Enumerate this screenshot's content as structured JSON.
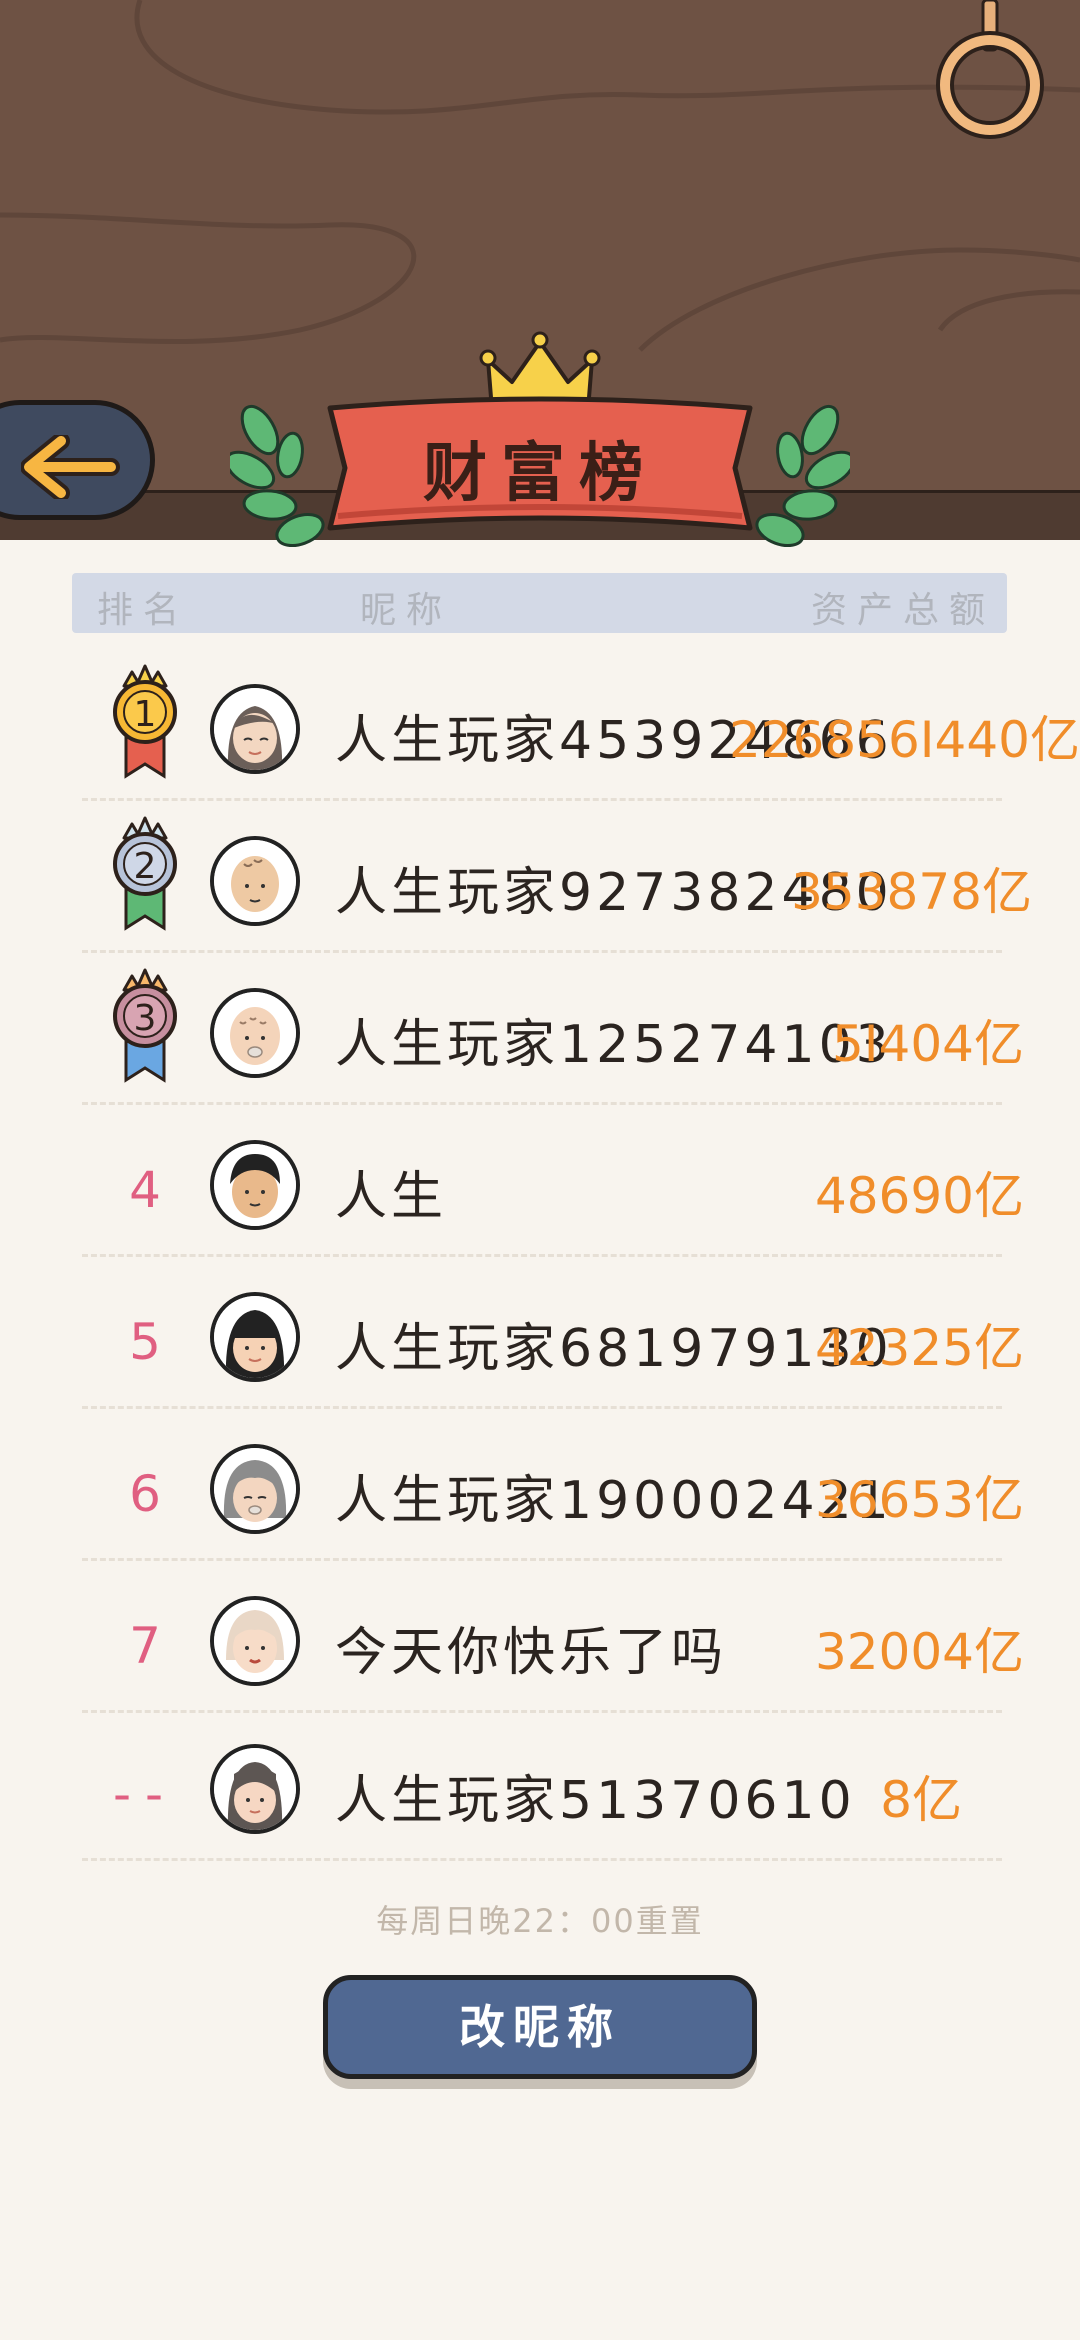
{
  "header": {
    "title": "财富榜",
    "back_icon": "back-arrow-icon",
    "crown_icon": "crown-icon",
    "laurel_icon": "laurel-icon"
  },
  "table": {
    "columns": [
      "排名",
      "昵称",
      "资产总额"
    ]
  },
  "rows": [
    {
      "rank": "1",
      "nickname": "人生玩家453924866",
      "wealth": "226856I440亿"
    },
    {
      "rank": "2",
      "nickname": "人生玩家927382480",
      "wealth": "353878亿"
    },
    {
      "rank": "3",
      "nickname": "人生玩家125274103",
      "wealth": "5I404亿"
    },
    {
      "rank": "4",
      "nickname": "人生",
      "wealth": "48690亿"
    },
    {
      "rank": "5",
      "nickname": "人生玩家681979130",
      "wealth": "42325亿"
    },
    {
      "rank": "6",
      "nickname": "人生玩家190002421",
      "wealth": "36653亿"
    },
    {
      "rank": "7",
      "nickname": "今天你快乐了吗",
      "wealth": "32004亿"
    },
    {
      "rank": "--",
      "nickname": "人生玩家51370610",
      "wealth": "8亿"
    }
  ],
  "footer": {
    "reset_note": "每周日晚22：00重置",
    "rename_button": "改昵称"
  },
  "colors": {
    "header_bg": "#6e5244",
    "banner": "#e5604f",
    "rank_text": "#e05f81",
    "wealth_text": "#f08d2a",
    "button": "#506892"
  }
}
